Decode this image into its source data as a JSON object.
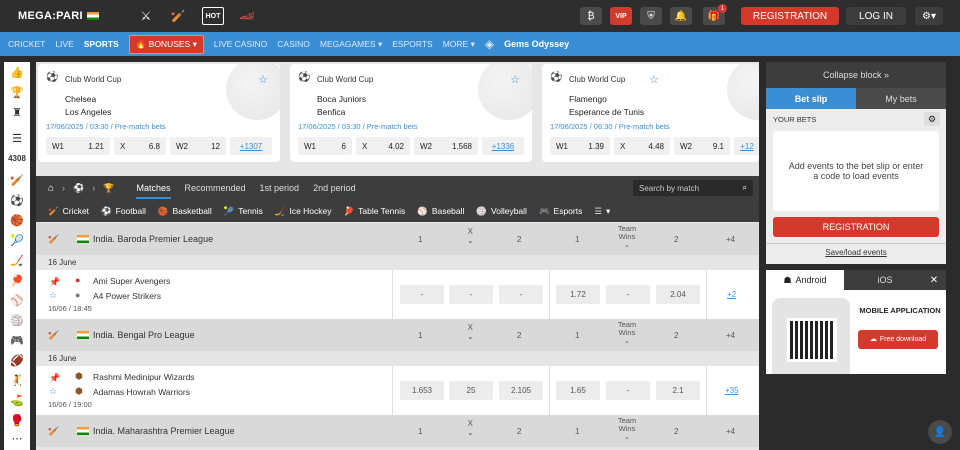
{
  "header": {
    "logo_text": "MEGA:PARI",
    "vip_label": "VIP",
    "notification_count": "1",
    "registration_label": "REGISTRATION",
    "login_label": "LOG IN"
  },
  "nav": {
    "items": [
      "CRICKET",
      "LIVE",
      "SPORTS",
      "BONUSES",
      "LIVE CASINO",
      "CASINO",
      "MEGAGAMES",
      "ESPORTS",
      "MORE"
    ],
    "active": "SPORTS",
    "promo": "Gems Odyssey"
  },
  "leftbar": {
    "count": "4308"
  },
  "featured": [
    {
      "league": "Club World Cup",
      "team1": "Chelsea",
      "team2": "Los Angeles",
      "datetime": "17/06/2025 / 03:30 / Pre-match bets",
      "odds": [
        {
          "l": "W1",
          "v": "1.21"
        },
        {
          "l": "X",
          "v": "6.8"
        },
        {
          "l": "W2",
          "v": "12"
        }
      ],
      "more": "+1307"
    },
    {
      "league": "Club World Cup",
      "team1": "Boca Juniors",
      "team2": "Benfica",
      "datetime": "17/06/2025 / 03:30 / Pre-match bets",
      "odds": [
        {
          "l": "W1",
          "v": "6"
        },
        {
          "l": "X",
          "v": "4.02"
        },
        {
          "l": "W2",
          "v": "1.568"
        }
      ],
      "more": "+1336"
    },
    {
      "league": "Club World Cup",
      "team1": "Flamengo",
      "team2": "Esperance de Tunis",
      "datetime": "17/06/2025 / 06:30 / Pre-match bets",
      "odds": [
        {
          "l": "W1",
          "v": "1.39"
        },
        {
          "l": "X",
          "v": "4.48"
        },
        {
          "l": "W2",
          "v": "9.1"
        }
      ],
      "more": "+12"
    }
  ],
  "tabs": {
    "items": [
      "Matches",
      "Recommended",
      "1st period",
      "2nd period"
    ],
    "active": "Matches",
    "search_placeholder": "Search by match"
  },
  "sports": [
    "Cricket",
    "Football",
    "Basketball",
    "Tennis",
    "Ice Hockey",
    "Table Tennis",
    "Baseball",
    "Volleyball",
    "Esports"
  ],
  "col_headers": {
    "c1": "1",
    "cx": "X",
    "c2": "2",
    "tw1": "1",
    "tw": "Team Wins",
    "tw2": "2",
    "plus": "+4"
  },
  "leagues": [
    {
      "name": "India. Baroda Premier League",
      "date": "16 June",
      "match": {
        "team1": "Ami Super Avengers",
        "team2": "A4 Power Strikers",
        "time": "16/06 / 18:45",
        "odds": [
          "-",
          "-",
          "-",
          "1.72",
          "-",
          "2.04"
        ],
        "more": "+2"
      }
    },
    {
      "name": "India. Bengal Pro League",
      "date": "16 June",
      "match": {
        "team1": "Rashmi Medinipur Wizards",
        "team2": "Adamas Howrah Warriors",
        "time": "16/06 / 19:00",
        "odds": [
          "1.653",
          "25",
          "2.105",
          "1.65",
          "-",
          "2.1"
        ],
        "more": "+35"
      }
    },
    {
      "name": "India. Maharashtra Premier League"
    }
  ],
  "betslip": {
    "collapse": "Collapse block",
    "tab1": "Bet slip",
    "tab2": "My bets",
    "your_bets": "YOUR BETS",
    "empty_msg": "Add events to the bet slip or enter a code to load events",
    "register": "REGISTRATION",
    "save_load": "Save/load events"
  },
  "app": {
    "android": "Android",
    "ios": "iOS",
    "title": "MOBILE APPLICATION",
    "download": "Free download"
  }
}
